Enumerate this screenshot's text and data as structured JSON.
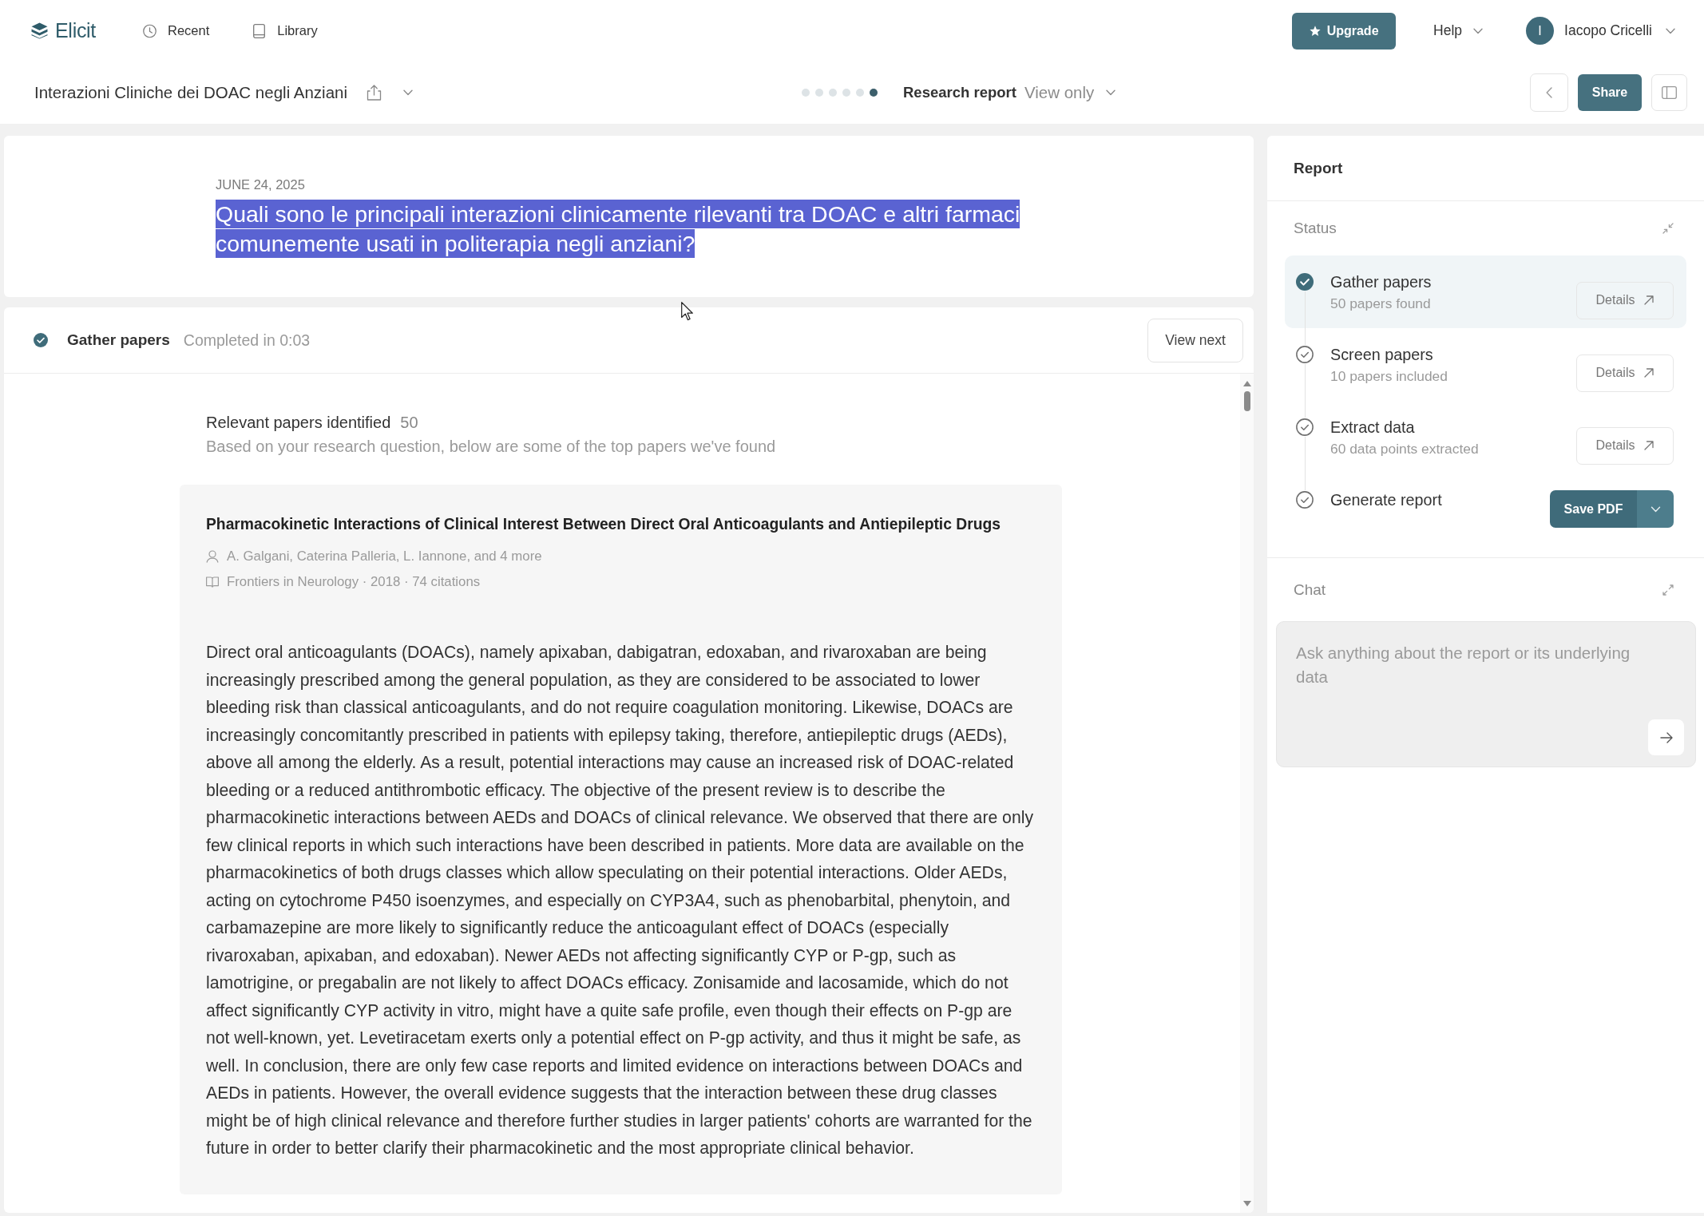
{
  "nav": {
    "logo": "Elicit",
    "links": [
      {
        "kind": "recent",
        "label": "Recent"
      },
      {
        "kind": "library",
        "label": "Library"
      }
    ],
    "upgrade_button": "Upgrade",
    "help": "Help",
    "user": {
      "initial": "I",
      "name": "Iacopo Cricelli"
    }
  },
  "toolbar": {
    "project_title": "Interazioni Cliniche dei DOAC negli Anziani",
    "progress_dots": [
      {
        "selected": false
      },
      {
        "selected": false
      },
      {
        "selected": false
      },
      {
        "selected": false
      },
      {
        "selected": false
      },
      {
        "selected": true
      }
    ],
    "report_type": "Research report",
    "access": "View only",
    "share_button": "Share"
  },
  "question_card": {
    "date": "JUNE 24, 2025",
    "question": "Quali sono le principali interazioni clinicamente rilevanti tra DOAC e altri farmaci comunemente usati in politerapia negli anziani?",
    "text_selected": true
  },
  "step_panel": {
    "step": "Gather papers",
    "status": "Completed in 0:03",
    "next_button": "View next",
    "count_label": "Relevant papers identified",
    "count": "50",
    "description": "Based on your research question, below are some of the top papers we've found",
    "papers": [
      {
        "title": "Pharmacokinetic Interactions of Clinical Interest Between Direct Oral Anticoagulants and Antiepileptic Drugs",
        "authors": "A. Galgani, Caterina Palleria, L. Iannone, and 4 more",
        "source": "Frontiers in Neurology · 2018 · 74 citations",
        "abstract": "Direct oral anticoagulants (DOACs), namely apixaban, dabigatran, edoxaban, and rivaroxaban are being increasingly prescribed among the general population, as they are considered to be associated to lower bleeding risk than classical anticoagulants, and do not require coagulation monitoring. Likewise, DOACs are increasingly concomitantly prescribed in patients with epilepsy taking, therefore, antiepileptic drugs (AEDs), above all among the elderly. As a result, potential interactions may cause an increased risk of DOAC-related bleeding or a reduced antithrombotic efficacy. The objective of the present review is to describe the pharmacokinetic interactions between AEDs and DOACs of clinical relevance. We observed that there are only few clinical reports in which such interactions have been described in patients. More data are available on the pharmacokinetics of both drugs classes which allow speculating on their potential interactions. Older AEDs, acting on cytochrome P450 isoenzymes, and especially on CYP3A4, such as phenobarbital, phenytoin, and carbamazepine are more likely to significantly reduce the anticoagulant effect of DOACs (especially rivaroxaban, apixaban, and edoxaban). Newer AEDs not affecting significantly CYP or P-gp, such as lamotrigine, or pregabalin are not likely to affect DOACs efficacy. Zonisamide and lacosamide, which do not affect significantly CYP activity in vitro, might have a quite safe profile, even though their effects on P-gp are not well-known, yet. Levetiracetam exerts only a potential effect on P-gp activity, and thus it might be safe, as well. In conclusion, there are only few case reports and limited evidence on interactions between DOACs and AEDs in patients. However, the overall evidence suggests that the interaction between these drug classes might be of high clinical relevance and therefore further studies in larger patients' cohorts are warranted for the future in order to better clarify their pharmacokinetic and the most appropriate clinical behavior."
      }
    ]
  },
  "report_panel": {
    "title": "Report",
    "status_label": "Status",
    "steps": [
      {
        "name": "Gather papers",
        "detail": "50 papers found",
        "selected": true,
        "action": {
          "kind": "details",
          "label": "Details"
        }
      },
      {
        "name": "Screen papers",
        "detail": "10 papers included",
        "selected": false,
        "action": {
          "kind": "details",
          "label": "Details"
        }
      },
      {
        "name": "Extract data",
        "detail": "60 data points extracted",
        "selected": false,
        "action": {
          "kind": "details",
          "label": "Details"
        }
      },
      {
        "name": "Generate report",
        "selected": false,
        "action": {
          "kind": "save",
          "label": "Save PDF"
        }
      }
    ],
    "chat_label": "Chat",
    "chat_placeholder": "Ask anything about the report or its underlying data"
  }
}
